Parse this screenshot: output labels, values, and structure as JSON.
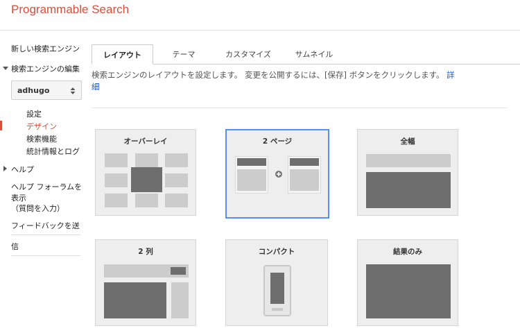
{
  "app": {
    "title": "Programmable Search"
  },
  "sidebar": {
    "new_engine": "新しい検索エンジン",
    "edit_engine": "検索エンジンの編集",
    "engine_select_value": "adhugo",
    "sub_items": [
      "設定",
      "デザイン",
      "検索機能",
      "統計情報とログ"
    ],
    "help": "ヘルプ",
    "forum_lines": [
      "ヘルプ フォーラムを",
      "表示",
      "（質問を入力）"
    ],
    "feedback_lines": [
      "フィードバックを送",
      "信"
    ]
  },
  "tabs": [
    {
      "label": "レイアウト",
      "active": true
    },
    {
      "label": "テーマ",
      "active": false
    },
    {
      "label": "カスタマイズ",
      "active": false
    },
    {
      "label": "サムネイル",
      "active": false
    }
  ],
  "description": {
    "text": "検索エンジンのレイアウトを設定します。 変更を公開するには、[保存] ボタンをクリックします。",
    "link_line1": "詳",
    "link_line2": "細"
  },
  "layouts": [
    {
      "title": "オーバーレイ",
      "selected": false
    },
    {
      "title": "2 ページ",
      "selected": true
    },
    {
      "title": "全幅",
      "selected": false
    },
    {
      "title": "2 列",
      "selected": false
    },
    {
      "title": "コンパクト",
      "selected": false
    },
    {
      "title": "結果のみ",
      "selected": false
    }
  ],
  "colors": {
    "brand": "#dd4b39",
    "active_tab_border": "#cccccc",
    "selected_card": "#4d90fe",
    "link": "#1155cc"
  },
  "icons": [
    "sort-arrows-icon",
    "caret-down-icon",
    "caret-right-icon",
    "plus-circle-icon"
  ]
}
